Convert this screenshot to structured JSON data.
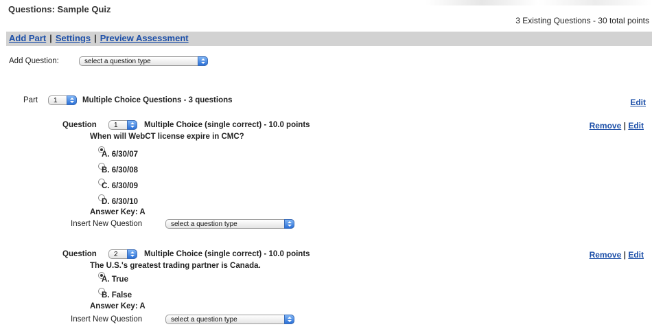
{
  "header": {
    "title": "Questions: Sample Quiz",
    "summary": "3 Existing Questions - 30 total points"
  },
  "nav": {
    "add_part": "Add Part",
    "settings": "Settings",
    "preview": "Preview Assessment",
    "separator": "|"
  },
  "add_question": {
    "label": "Add Question:",
    "select_value": "select a question type"
  },
  "part": {
    "label": "Part",
    "number": "1",
    "title": "Multiple Choice Questions - 3 questions",
    "edit": "Edit"
  },
  "questions": [
    {
      "label": "Question",
      "number": "1",
      "title": "Multiple Choice (single correct) - 10.0 points",
      "remove": "Remove",
      "separator": "|",
      "edit": "Edit",
      "prompt": "When will WebCT license expire in CMC?",
      "options": [
        "A. 6/30/07",
        "B. 6/30/08",
        "C. 6/30/09",
        "D. 6/30/10"
      ],
      "selected_option": "A. 6/30/07",
      "answer_key": "Answer Key: A",
      "insert_label": "Insert New Question",
      "insert_select_value": "select a question type"
    },
    {
      "label": "Question",
      "number": "2",
      "title": "Multiple Choice (single correct) - 10.0 points",
      "remove": "Remove",
      "separator": "|",
      "edit": "Edit",
      "prompt": "The U.S.'s greatest trading partner is Canada.",
      "options": [
        "A. True",
        "B. False"
      ],
      "selected_option": "A. True",
      "answer_key": "Answer Key: A",
      "insert_label": "Insert New Question",
      "insert_select_value": "select a question type"
    }
  ]
}
